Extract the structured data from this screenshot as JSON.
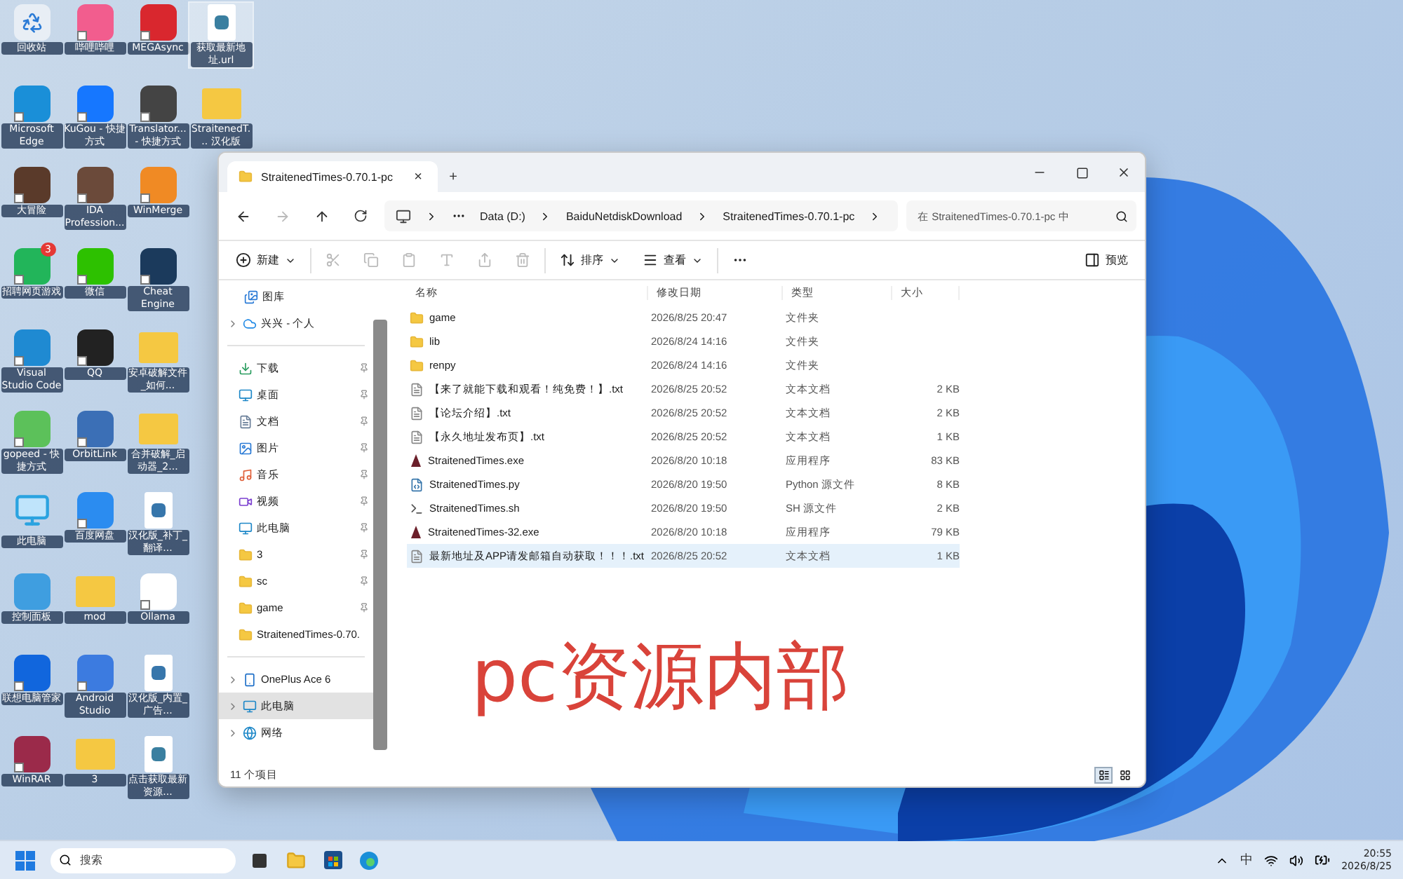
{
  "desktop_icons": [
    {
      "label": "回收站",
      "kind": "recycle",
      "color": "#e8eef5",
      "shortcut": false,
      "selected": false
    },
    {
      "label": "Microsoft Edge",
      "kind": "app",
      "color": "#1a8fd8",
      "shortcut": true,
      "selected": false
    },
    {
      "label": "大冒险",
      "kind": "app",
      "color": "#5a3a2a",
      "shortcut": true,
      "selected": false
    },
    {
      "label": "招聘网页游戏",
      "kind": "app",
      "color": "#22b55a",
      "shortcut": true,
      "selected": false,
      "badge": "3"
    },
    {
      "label": "Visual Studio Code",
      "kind": "app",
      "color": "#1f8ad2",
      "shortcut": true,
      "selected": false
    },
    {
      "label": "gopeed - 快捷方式",
      "kind": "app",
      "color": "#5cc15a",
      "shortcut": true,
      "selected": false
    },
    {
      "label": "此电脑",
      "kind": "pc",
      "color": "#2aa3e0",
      "shortcut": false,
      "selected": false
    },
    {
      "label": "控制面板",
      "kind": "app",
      "color": "#3f9ee0",
      "shortcut": false,
      "selected": false
    },
    {
      "label": "联想电脑管家",
      "kind": "app",
      "color": "#1166dd",
      "shortcut": true,
      "selected": false
    },
    {
      "label": "WinRAR",
      "kind": "app",
      "color": "#9b2a4a",
      "shortcut": true,
      "selected": false
    },
    {
      "label": "哔哩哔哩",
      "kind": "app",
      "color": "#f25d8e",
      "shortcut": true,
      "selected": false
    },
    {
      "label": "KuGou - 快捷方式",
      "kind": "app",
      "color": "#1677ff",
      "shortcut": true,
      "selected": false
    },
    {
      "label": "IDA Profession...",
      "kind": "app",
      "color": "#6b4a3a",
      "shortcut": true,
      "selected": false
    },
    {
      "label": "微信",
      "kind": "app",
      "color": "#2dc100",
      "shortcut": true,
      "selected": false
    },
    {
      "label": "QQ",
      "kind": "app",
      "color": "#222222",
      "shortcut": true,
      "selected": false
    },
    {
      "label": "OrbitLink",
      "kind": "app",
      "color": "#3b6fb6",
      "shortcut": true,
      "selected": false
    },
    {
      "label": "百度网盘",
      "kind": "app",
      "color": "#2b8cf0",
      "shortcut": true,
      "selected": false
    },
    {
      "label": "mod",
      "kind": "folder",
      "color": "#f5c842",
      "shortcut": false,
      "selected": false
    },
    {
      "label": "Android Studio",
      "kind": "app",
      "color": "#3c7be0",
      "shortcut": true,
      "selected": false
    },
    {
      "label": "3",
      "kind": "folder",
      "color": "#f5c842",
      "shortcut": false,
      "selected": false
    },
    {
      "label": "MEGAsync",
      "kind": "app",
      "color": "#d9272e",
      "shortcut": true,
      "selected": false
    },
    {
      "label": "Translator... - 快捷方式",
      "kind": "app",
      "color": "#444444",
      "shortcut": true,
      "selected": false
    },
    {
      "label": "WinMerge",
      "kind": "app",
      "color": "#f08a24",
      "shortcut": true,
      "selected": false
    },
    {
      "label": "Cheat Engine",
      "kind": "app",
      "color": "#1b3a5c",
      "shortcut": true,
      "selected": false
    },
    {
      "label": "安卓破解文件_如何...",
      "kind": "folder",
      "color": "#f5c842",
      "shortcut": false,
      "selected": false
    },
    {
      "label": "合并破解_启动器_2...",
      "kind": "folder",
      "color": "#f5c842",
      "shortcut": false,
      "selected": false
    },
    {
      "label": "汉化版_补丁_翻译...",
      "kind": "file",
      "color": "#3776ab",
      "shortcut": false,
      "selected": false
    },
    {
      "label": "Ollama",
      "kind": "app",
      "color": "#ffffff",
      "shortcut": true,
      "selected": false
    },
    {
      "label": "汉化版_内置_广告...",
      "kind": "file",
      "color": "#3776ab",
      "shortcut": false,
      "selected": false
    },
    {
      "label": "点击获取最新资源...",
      "kind": "file",
      "color": "#3a7fa0",
      "shortcut": false,
      "selected": false
    },
    {
      "label": "获取最新地址.url",
      "kind": "file",
      "color": "#3a7fa0",
      "shortcut": false,
      "selected": true
    },
    {
      "label": "StraitenedT... 汉化版",
      "kind": "folder",
      "color": "#f5c842",
      "shortcut": false,
      "selected": false
    }
  ],
  "explorer": {
    "tab": {
      "title": "StraitenedTimes-0.70.1-pc",
      "close": "×",
      "selected": true
    },
    "new_tab": "+",
    "breadcrumb": [
      "Data (D:)",
      "BaiduNetdiskDownload",
      "StraitenedTimes-0.70.1-pc"
    ],
    "search": {
      "placeholder": "在 StraitenedTimes-0.70.1-pc 中"
    },
    "toolbar": [
      {
        "kind": "new",
        "label": "新建",
        "dropdown": true,
        "disabled": false
      },
      {
        "kind": "cut",
        "disabled": true
      },
      {
        "kind": "copy",
        "disabled": true
      },
      {
        "kind": "paste",
        "disabled": true
      },
      {
        "kind": "rename",
        "disabled": true
      },
      {
        "kind": "share",
        "disabled": true
      },
      {
        "kind": "delete",
        "disabled": true
      },
      {
        "kind": "sort",
        "label": "排序",
        "dropdown": true,
        "disabled": false
      },
      {
        "kind": "view",
        "label": "查看",
        "dropdown": true,
        "disabled": false
      },
      {
        "kind": "more",
        "disabled": false
      }
    ],
    "preview_button": "预览",
    "sidebar": {
      "top": [
        {
          "label": "图库",
          "kind": "gallery",
          "expandable": false,
          "selected": false
        },
        {
          "label": "兴兴 - 个人",
          "kind": "cloud",
          "expandable": true,
          "selected": false
        }
      ],
      "quick_access": [
        {
          "label": "下载",
          "kind": "download",
          "pinned": true
        },
        {
          "label": "桌面",
          "kind": "desktop",
          "pinned": true
        },
        {
          "label": "文档",
          "kind": "documents",
          "pinned": true
        },
        {
          "label": "图片",
          "kind": "pictures",
          "pinned": true
        },
        {
          "label": "音乐",
          "kind": "music",
          "pinned": true
        },
        {
          "label": "视频",
          "kind": "videos",
          "pinned": true
        },
        {
          "label": "此电脑",
          "kind": "pc",
          "pinned": true
        },
        {
          "label": "3",
          "kind": "folder",
          "pinned": true
        },
        {
          "label": "sc",
          "kind": "folder",
          "pinned": true
        },
        {
          "label": "game",
          "kind": "folder",
          "pinned": true
        },
        {
          "label": "StraitenedTimes-0.70.",
          "kind": "folder",
          "pinned": false
        }
      ],
      "devices": [
        {
          "label": "OnePlus Ace 6",
          "kind": "phone",
          "expandable": true,
          "selected": false
        },
        {
          "label": "此电脑",
          "kind": "pc",
          "expandable": true,
          "selected": true
        },
        {
          "label": "网络",
          "kind": "network",
          "expandable": true,
          "selected": false
        }
      ]
    },
    "columns": [
      "名称",
      "修改日期",
      "类型",
      "大小"
    ],
    "files": [
      {
        "name": "game",
        "kind": "folder",
        "modified": "2026/8/25 20:47",
        "type": "文件夹",
        "selected": false
      },
      {
        "name": "lib",
        "kind": "folder",
        "modified": "2026/8/24 14:16",
        "type": "文件夹",
        "selected": false
      },
      {
        "name": "renpy",
        "kind": "folder",
        "modified": "2026/8/24 14:16",
        "type": "文件夹",
        "selected": false
      },
      {
        "name": "【来了就能下载和观看！纯免费！】.txt",
        "kind": "txt",
        "modified": "2026/8/25 20:52",
        "type": "文本文档",
        "size": "2 KB",
        "selected": false
      },
      {
        "name": "【论坛介绍】.txt",
        "kind": "txt",
        "modified": "2026/8/25 20:52",
        "type": "文本文档",
        "size": "2 KB",
        "selected": false
      },
      {
        "name": "【永久地址发布页】.txt",
        "kind": "txt",
        "modified": "2026/8/25 20:52",
        "type": "文本文档",
        "size": "1 KB",
        "selected": false
      },
      {
        "name": "StraitenedTimes.exe",
        "kind": "exe",
        "modified": "2026/8/20 10:18",
        "type": "应用程序",
        "size": "83 KB",
        "selected": false
      },
      {
        "name": "StraitenedTimes.py",
        "kind": "py",
        "modified": "2026/8/20 19:50",
        "type": "Python 源文件",
        "size": "8 KB",
        "selected": false
      },
      {
        "name": "StraitenedTimes.sh",
        "kind": "sh",
        "modified": "2026/8/20 19:50",
        "type": "SH 源文件",
        "size": "2 KB",
        "selected": false
      },
      {
        "name": "StraitenedTimes-32.exe",
        "kind": "exe",
        "modified": "2026/8/20 10:18",
        "type": "应用程序",
        "size": "79 KB",
        "selected": false
      },
      {
        "name": "最新地址及APP请发邮箱自动获取！！！.txt",
        "kind": "txt",
        "modified": "2026/8/25 20:52",
        "type": "文本文档",
        "size": "1 KB",
        "selected": true
      }
    ],
    "status": "11 个项目",
    "views": [
      {
        "kind": "details",
        "selected": true
      },
      {
        "kind": "tiles",
        "selected": false
      }
    ]
  },
  "overlay_caption": "pc资源内部",
  "taskbar": {
    "search": {
      "placeholder": "搜索"
    },
    "ime": "中",
    "time": "20:55",
    "date": "2026/8/25"
  }
}
